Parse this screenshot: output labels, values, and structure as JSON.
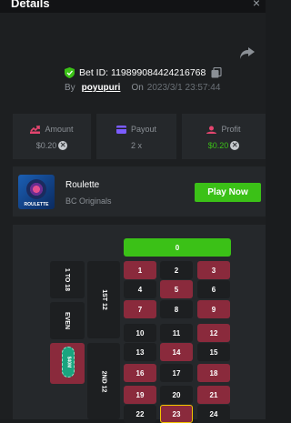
{
  "header": {
    "title": "Details",
    "close_label": "×"
  },
  "bet": {
    "id_text": "Bet ID: 119899084424216768",
    "by_label": "By",
    "username": "poyupuri",
    "on_label": "On",
    "date": "2023/3/1 23:57:44"
  },
  "stats": {
    "amount_label": "Amount",
    "amount_value": "$0.20",
    "payout_label": "Payout",
    "payout_value": "2 x",
    "profit_label": "Profit",
    "profit_value": "$0.20"
  },
  "game": {
    "name": "Roulette",
    "provider": "BC Originals",
    "play_label": "Play Now",
    "thumb_label": "ROULETTE"
  },
  "roulette": {
    "zero": "0",
    "numbers": [
      "1",
      "2",
      "3",
      "4",
      "5",
      "6",
      "7",
      "8",
      "9",
      "10",
      "11",
      "12",
      "13",
      "14",
      "15",
      "16",
      "17",
      "18",
      "19",
      "20",
      "21",
      "22",
      "23",
      "24"
    ],
    "side_1to18": "1 TO 18",
    "side_even": "EVEN",
    "dozen_1": "1ST 12",
    "dozen_2": "2ND 12",
    "chip_label": "$40M"
  },
  "colors": {
    "accent_green": "#3bc117",
    "red_cell": "#8a2a3c",
    "black_cell": "#1d1f21"
  }
}
